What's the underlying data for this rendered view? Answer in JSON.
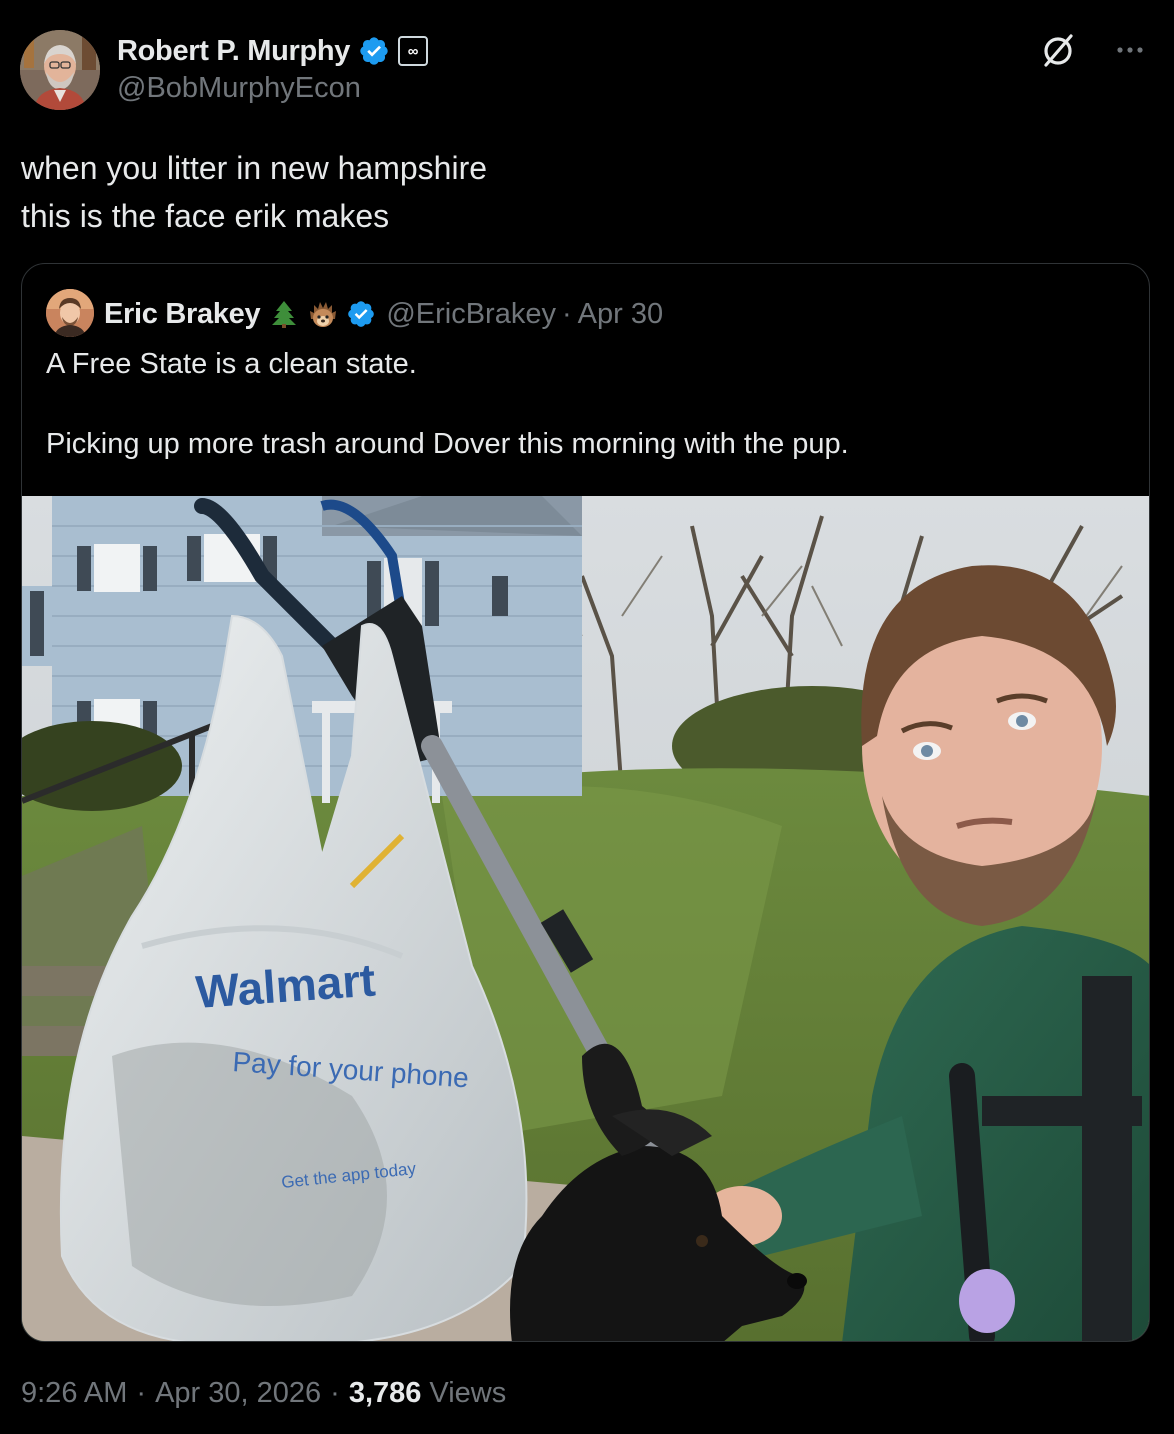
{
  "author": {
    "display_name": "Robert P. Murphy",
    "handle": "@BobMurphyEcon",
    "verified_icon": "verified-badge-icon",
    "affiliate_badge": "∞"
  },
  "tweet": {
    "lines": [
      "when you litter in new hampshire",
      "this is the face erik makes"
    ]
  },
  "quoted": {
    "display_name": "Eric Brakey",
    "emojis": [
      "evergreen-tree-icon",
      "hedgehog-icon"
    ],
    "handle": "@EricBrakey",
    "separator": "·",
    "date": "Apr 30",
    "paragraphs": [
      "A Free State is a clean state.",
      "Picking up more trash around Dover this morning with the pup."
    ],
    "photo": {
      "bag_brand": "Walmart",
      "bag_tagline": "Pay for your phone",
      "bag_small": "Get the app today"
    }
  },
  "meta": {
    "time": "9:26 AM",
    "sep": "·",
    "date": "Apr 30, 2026",
    "sep2": "·",
    "views_count": "3,786",
    "views_label": "Views"
  },
  "colors": {
    "background": "#000000",
    "text": "#e7e9ea",
    "muted": "#71767b",
    "verified_blue": "#1d9bf0",
    "border": "#2f3336"
  }
}
